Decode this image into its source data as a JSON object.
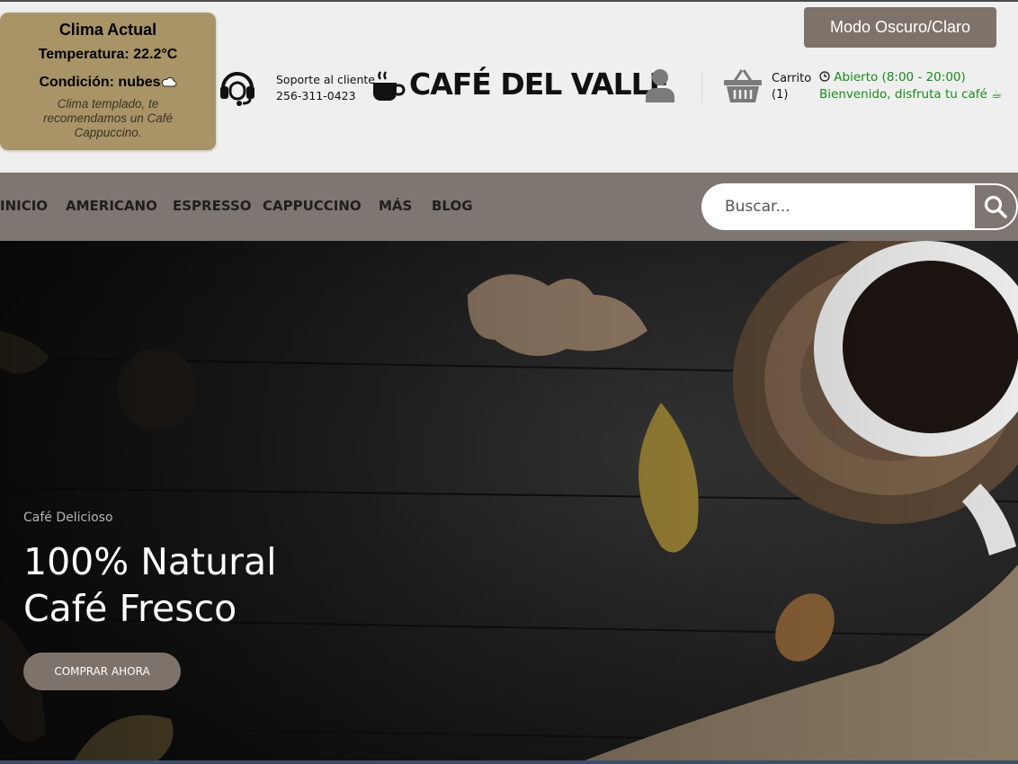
{
  "weather": {
    "title": "Clima Actual",
    "temperature": "Temperatura: 22.2°C",
    "condition": "Condición: nubes",
    "condition_icon": "cloud-icon",
    "note": "Clima templado, te recomendamos un Café Cappuccino."
  },
  "mode_button": "Modo Oscuro/Claro",
  "support": {
    "label": "Soporte al cliente",
    "phone": "256-311-0423"
  },
  "brand": "CAFÉ DEL VALLE",
  "cart": {
    "label": "Carrito",
    "count": "(1)"
  },
  "status": {
    "hours": "Abierto (8:00 - 20:00)",
    "welcome": "Bienvenido, disfruta tu café"
  },
  "nav": {
    "items": [
      "INICIO",
      "AMERICANO",
      "ESPRESSO",
      "CAPPUCCINO",
      "MÁS",
      "BLOG"
    ],
    "search_placeholder": "Buscar..."
  },
  "hero": {
    "subtitle": "Café Delicioso",
    "title_line1": "100% Natural",
    "title_line2": "Café Fresco",
    "button": "COMPRAR AHORA"
  },
  "colors": {
    "weather_bg": "#a99467",
    "accent": "#7e736b",
    "navbar": "#7e7670",
    "open_green": "#1a8a1a"
  }
}
